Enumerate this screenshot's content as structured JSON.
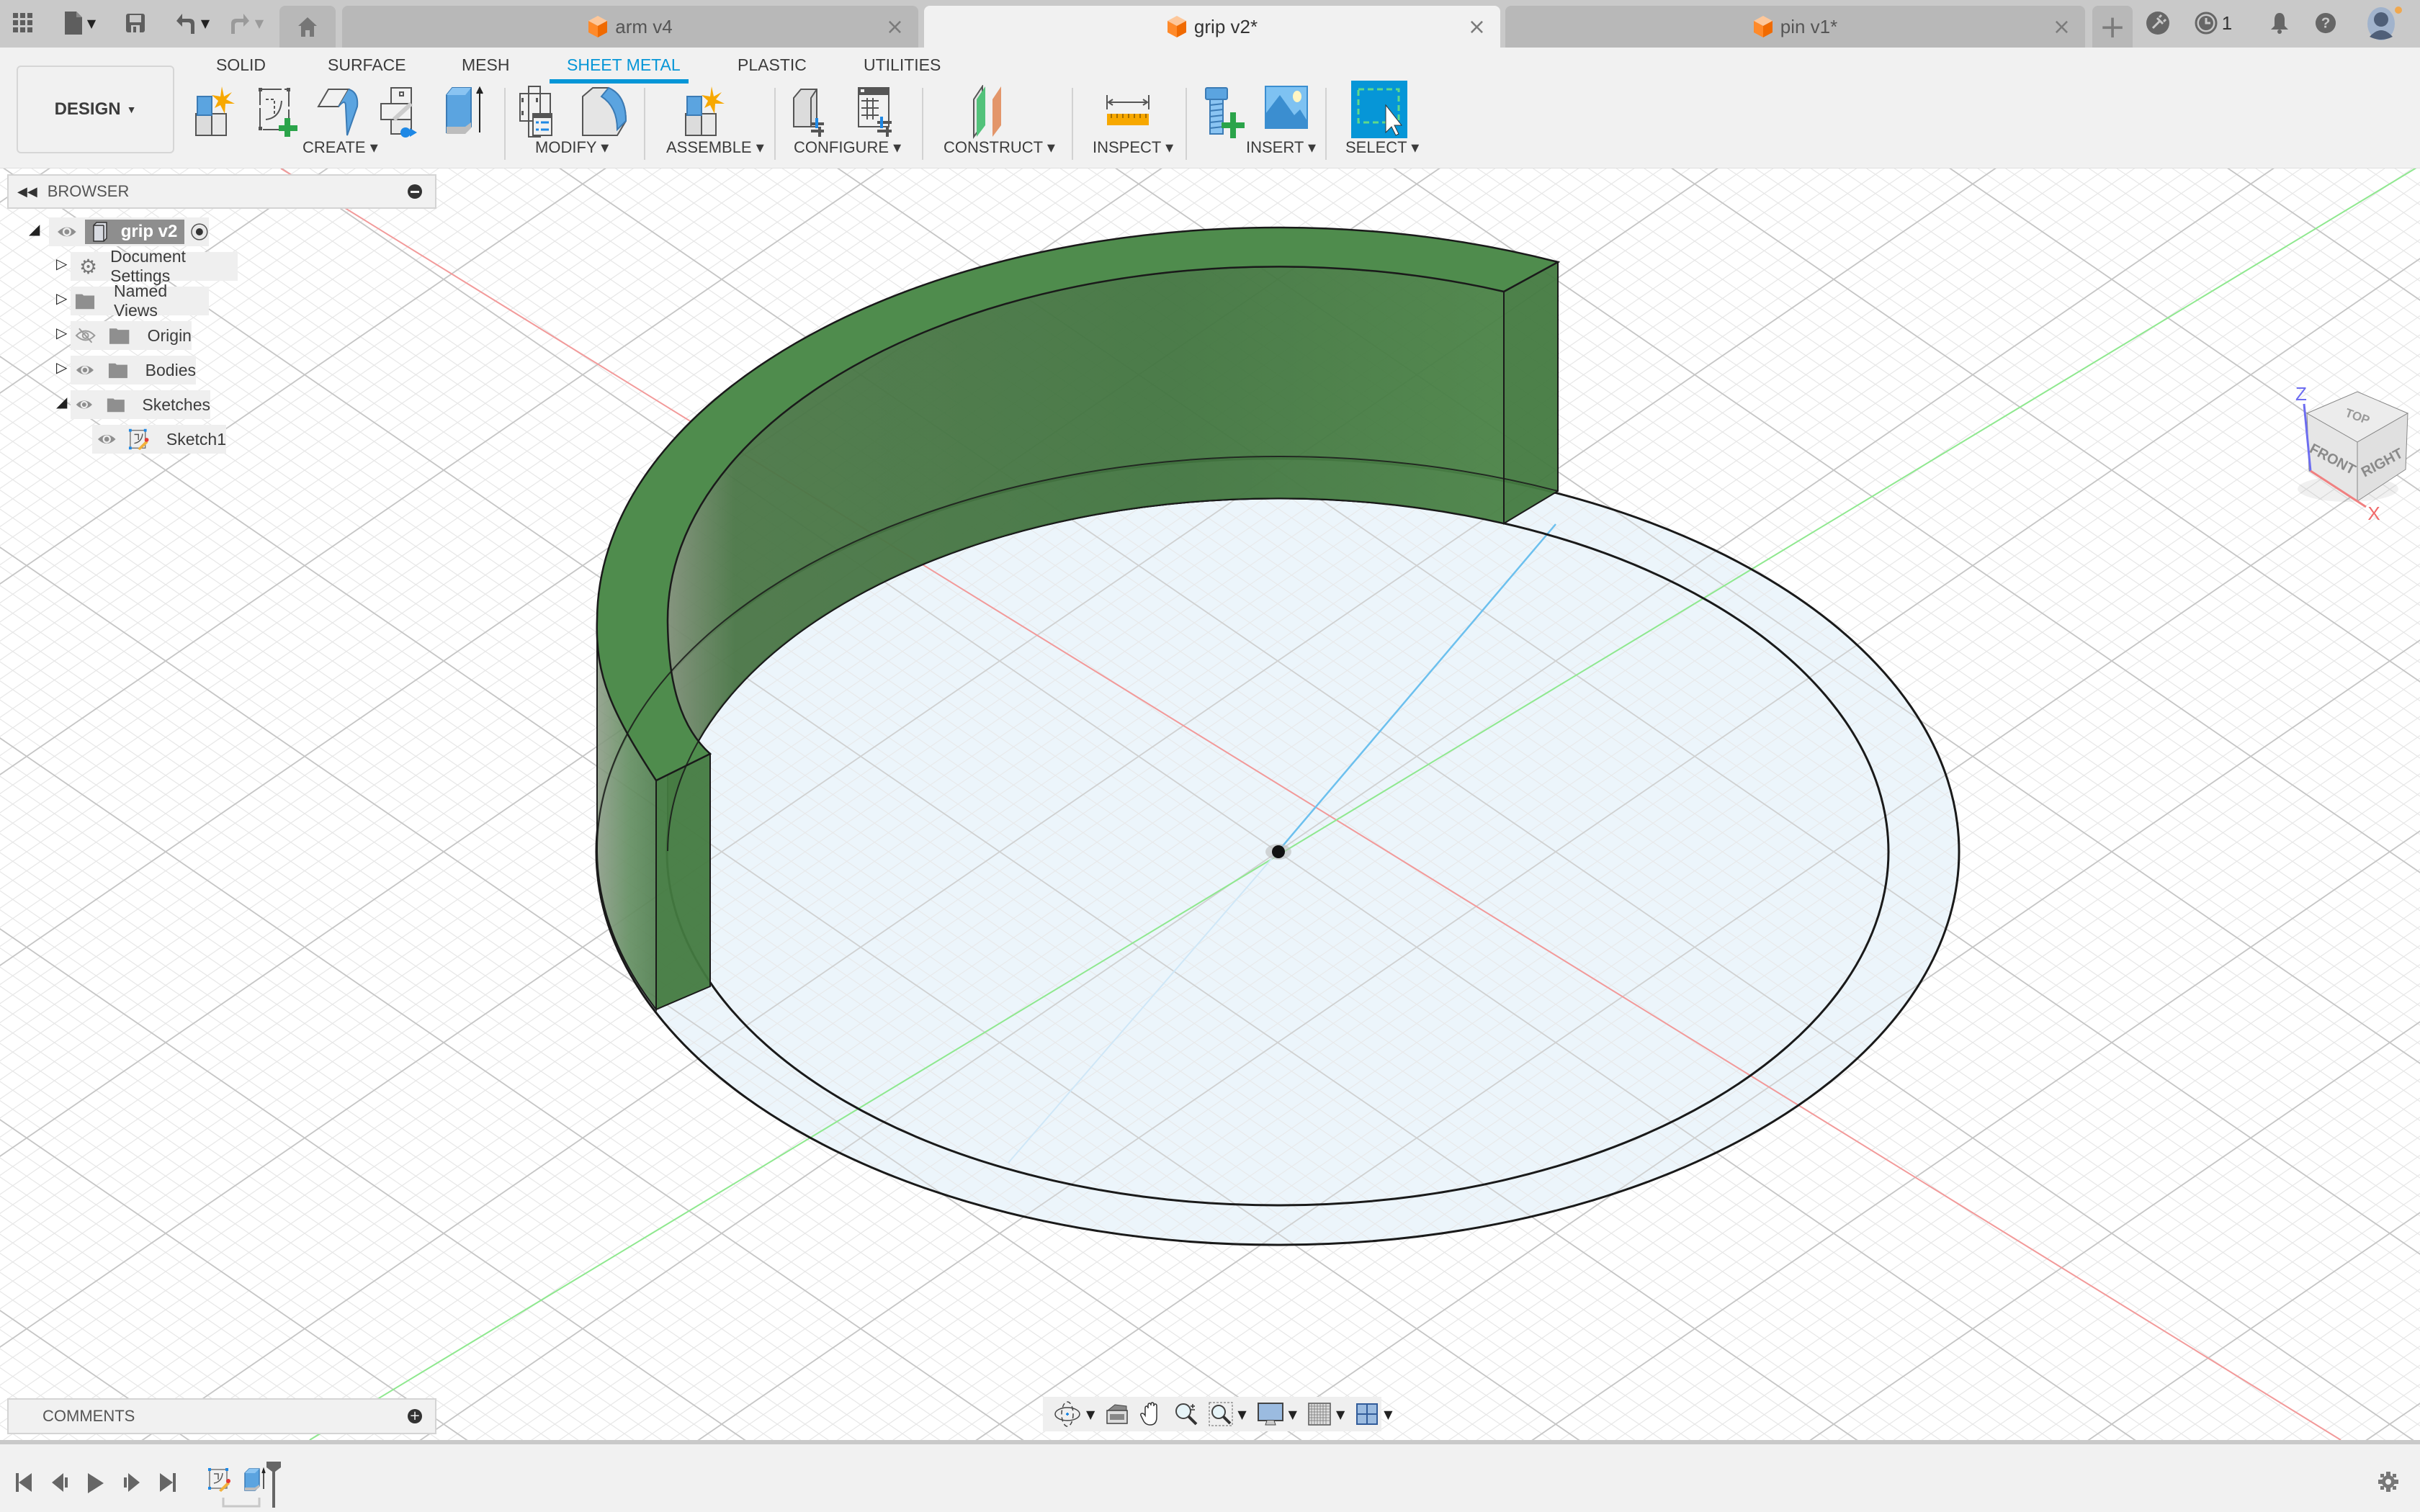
{
  "app": {
    "toolbar_icons": [
      "grid-menu-icon",
      "file-icon",
      "save-icon",
      "undo-icon",
      "redo-icon"
    ],
    "tabs": [
      {
        "label": "arm v4",
        "active": false,
        "icon": "design-cube-icon"
      },
      {
        "label": "grip v2*",
        "active": true,
        "icon": "design-cube-icon"
      },
      {
        "label": "pin v1*",
        "active": false,
        "icon": "design-cube-icon"
      }
    ],
    "job_status_count": "1",
    "brand_color": "#0696d7",
    "user_status_color": "#f0a84f"
  },
  "ribbon": {
    "workspace": "DESIGN",
    "workspace_caret": "▾",
    "tabs": [
      "SOLID",
      "SURFACE",
      "MESH",
      "SHEET METAL",
      "PLASTIC",
      "UTILITIES"
    ],
    "active_tab": "SHEET METAL",
    "groups": [
      {
        "label": "CREATE ▾",
        "tools": [
          "new-component-icon",
          "create-sketch-icon",
          "flange-icon",
          "unfold-icon",
          "extrude-icon"
        ]
      },
      {
        "label": "MODIFY ▾",
        "tools": [
          "sheet-metal-rules-icon",
          "bend-icon"
        ]
      },
      {
        "label": "ASSEMBLE ▾",
        "tools": [
          "assemble-new-component-icon"
        ]
      },
      {
        "label": "CONFIGURE ▾",
        "tools": [
          "configure-model-icon",
          "configure-table-icon"
        ]
      },
      {
        "label": "CONSTRUCT ▾",
        "tools": [
          "offset-plane-icon"
        ]
      },
      {
        "label": "INSPECT ▾",
        "tools": [
          "measure-icon"
        ]
      },
      {
        "label": "INSERT ▾",
        "tools": [
          "insert-mcmaster-icon",
          "insert-canvas-icon"
        ]
      },
      {
        "label": "SELECT ▾",
        "tools": [
          "select-window-icon"
        ]
      }
    ]
  },
  "browser": {
    "title": "BROWSER",
    "root": {
      "label": "grip v2",
      "expanded": true,
      "visible": true
    },
    "items": [
      {
        "label": "Document Settings",
        "icon": "gear-icon",
        "expanded": false,
        "visibility": null
      },
      {
        "label": "Named Views",
        "icon": "folder-icon",
        "expanded": false,
        "visibility": null
      },
      {
        "label": "Origin",
        "icon": "folder-icon",
        "expanded": false,
        "visibility": "hidden"
      },
      {
        "label": "Bodies",
        "icon": "folder-icon",
        "expanded": false,
        "visibility": "visible"
      },
      {
        "label": "Sketches",
        "icon": "folder-icon",
        "expanded": true,
        "visibility": "visible"
      }
    ],
    "children": [
      {
        "label": "Sketch1",
        "icon": "sketch-icon",
        "visibility": "visible"
      }
    ]
  },
  "comments": {
    "title": "COMMENTS"
  },
  "viewcube": {
    "faces": [
      "TOP",
      "FRONT",
      "RIGHT"
    ],
    "axes": [
      "Z",
      "X"
    ]
  },
  "navbar": {
    "tools": [
      "orbit-icon",
      "look-at-icon",
      "pan-icon",
      "zoom-icon",
      "fit-icon",
      "display-settings-icon",
      "grid-settings-icon",
      "viewports-icon"
    ]
  },
  "timeline": {
    "controls": [
      "go-to-start",
      "step-back",
      "play",
      "step-forward",
      "go-to-end"
    ],
    "features": [
      "Sketch1",
      "Extrude1"
    ]
  },
  "scene": {
    "body_color": "#4f8c4d",
    "sketch_fill": "#eaf4fb",
    "x_axis_color": "#f08080",
    "y_axis_color": "#7fe07f"
  }
}
